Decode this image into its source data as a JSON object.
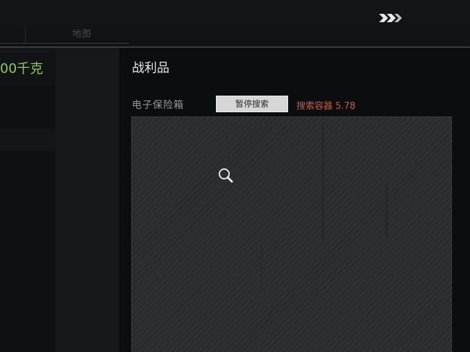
{
  "topbar": {
    "tab_label": "地图"
  },
  "left_panel": {
    "weight_text": "00千克"
  },
  "loot": {
    "title": "战利品",
    "container_label": "电子保险箱",
    "pause_button_label": "暂停搜索",
    "search_status": "搜索容器 5.78"
  },
  "colors": {
    "weight": "#8cc84b",
    "search_status": "#d9542c",
    "grid_bg": "#2b2c2d"
  }
}
